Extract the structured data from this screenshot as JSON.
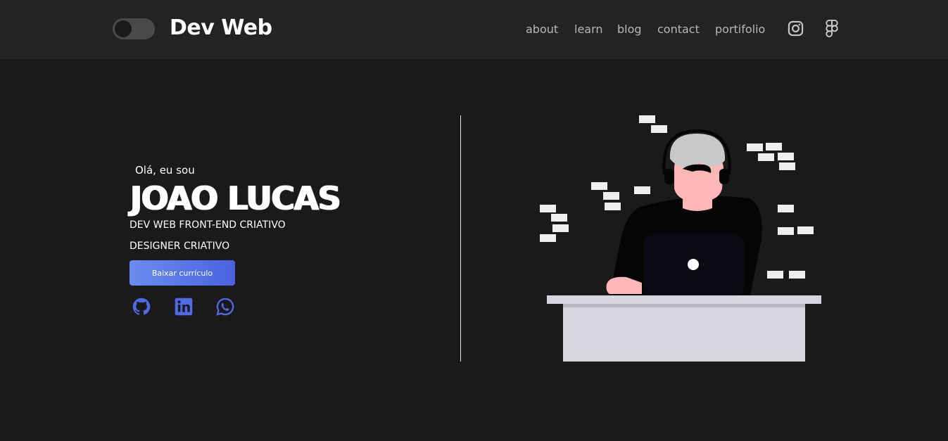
{
  "header": {
    "theme_toggle": {
      "state": "dark"
    },
    "brand": "Dev Web",
    "nav": [
      {
        "label": "about"
      },
      {
        "label": "learn"
      },
      {
        "label": "blog"
      },
      {
        "label": "contact"
      },
      {
        "label": "portifolio"
      }
    ],
    "icons": [
      "instagram-icon",
      "figma-icon"
    ]
  },
  "hero": {
    "greeting": "Olá, eu sou",
    "name": "JOAO LUCAS",
    "roles": [
      "DEV WEB FRONT-END CRIATIVO",
      "DESIGNER CRIATIVO"
    ],
    "cv_button": "Baixar currículo",
    "socials": [
      "github-icon",
      "linkedin-icon",
      "whatsapp-icon"
    ]
  },
  "colors": {
    "background": "#1a1a1a",
    "header": "#232323",
    "accent": "#4a62df",
    "nav_text": "#b8b8b8"
  }
}
